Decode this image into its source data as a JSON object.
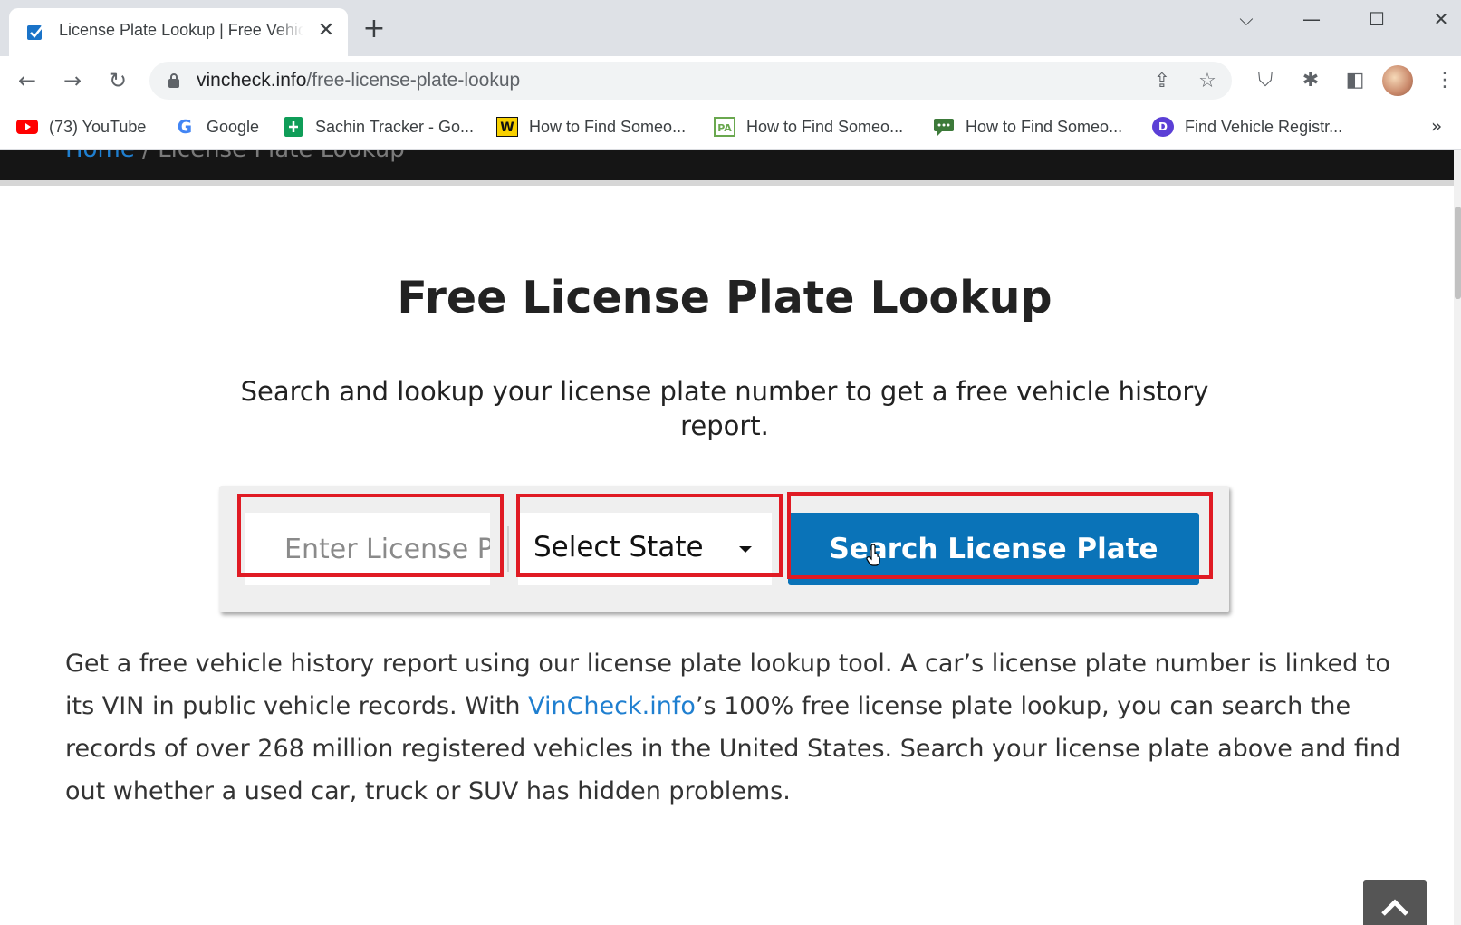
{
  "browser": {
    "tab": {
      "title": "License Plate Lookup | Free Vehicle History Report",
      "close_glyph": "✕",
      "favicon": "vincheck-checkbox-icon"
    },
    "new_tab_glyph": "+",
    "window_controls": {
      "dropdown": "⌵",
      "minimize": "—",
      "maximize": "☐",
      "close": "✕"
    },
    "nav": {
      "back": "←",
      "forward": "→",
      "reload": "↻"
    },
    "address": {
      "domain": "vincheck.info",
      "path": "/free-license-plate-lookup"
    },
    "omnibox_icons": {
      "share": "⇪",
      "bookmark_star": "☆"
    },
    "toolbar_icons": {
      "shield": "⛉",
      "extensions": "✱",
      "side_panel": "◧",
      "menu": "⋮"
    },
    "bookmarks": [
      {
        "label": "(73) YouTube",
        "icon": "youtube-icon",
        "color": "#ff0000"
      },
      {
        "label": "Google",
        "icon": "google-icon",
        "color": "#4285f4"
      },
      {
        "label": "Sachin Tracker - Go...",
        "icon": "google-sheets-icon",
        "color": "#0f9d58"
      },
      {
        "label": "How to Find Someo...",
        "icon": "w-icon",
        "color": "#f7d000"
      },
      {
        "label": "How to Find Someo...",
        "icon": "pa-icon",
        "color": "#6aa84f"
      },
      {
        "label": "How to Find Someo...",
        "icon": "chat-icon",
        "color": "#3d7a3a"
      },
      {
        "label": "Find Vehicle Registr...",
        "icon": "d-icon",
        "color": "#5b3fd6"
      }
    ],
    "bookmarks_more": "»"
  },
  "page": {
    "breadcrumb": {
      "home": "Home",
      "separator": "/",
      "current": "License Plate Lookup"
    },
    "title": "Free License Plate Lookup",
    "subtitle": "Search and lookup your license plate number to get a free vehicle history report.",
    "search": {
      "plate_placeholder": "Enter License Plate",
      "state_selected": "Select State",
      "button_label": "Search License Plate"
    },
    "body": {
      "part1": "Get a free vehicle history report using our license plate lookup tool. A car’s license plate number is linked to its VIN in public vehicle records. With ",
      "link": "VinCheck.info",
      "part2": "’s 100% free license plate lookup, you can search the records of over 268 million registered vehicles in the United States. Search your license plate above and find out whether a used car, truck or SUV has hidden problems."
    },
    "colors": {
      "accent": "#0a73b8",
      "link": "#1f7fd0",
      "highlight": "#e01b24"
    }
  }
}
